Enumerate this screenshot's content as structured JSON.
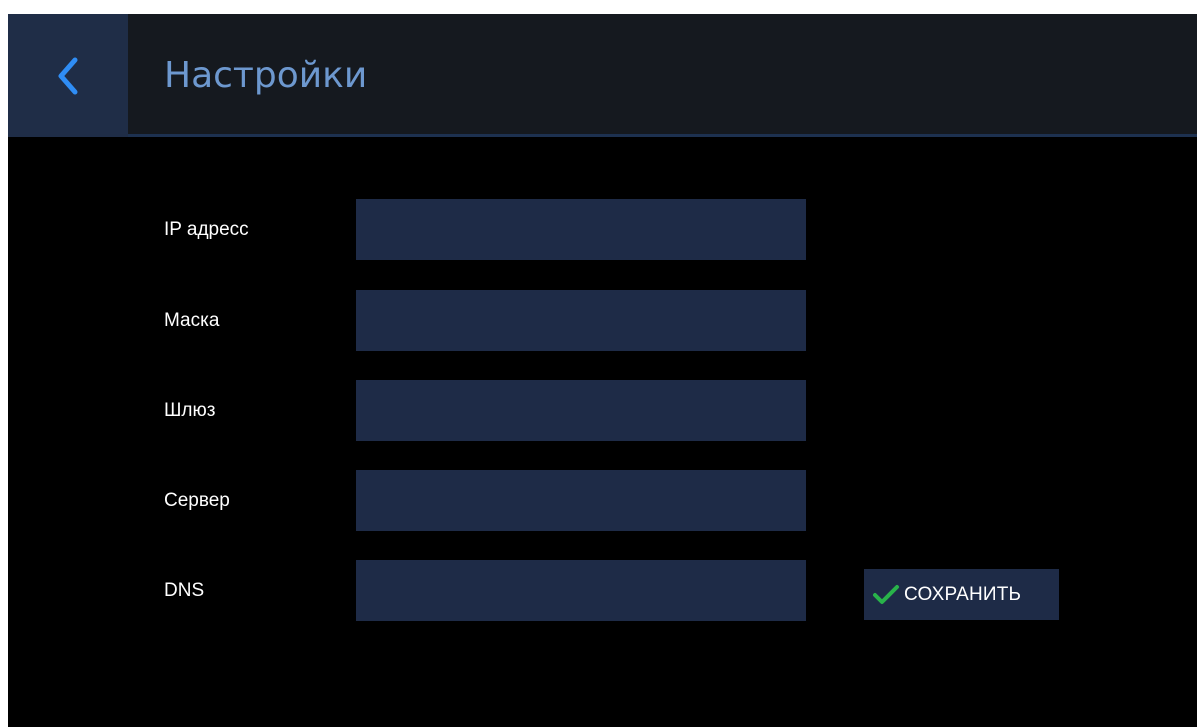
{
  "header": {
    "title": "Настройки",
    "back_icon": "chevron-left-icon"
  },
  "form": {
    "fields": [
      {
        "label": "IP адресс",
        "value": "",
        "placeholder": ""
      },
      {
        "label": "Маска",
        "value": "",
        "placeholder": ""
      },
      {
        "label": "Шлюз",
        "value": "",
        "placeholder": ""
      },
      {
        "label": "Сервер",
        "value": "",
        "placeholder": ""
      },
      {
        "label": "DNS",
        "value": "",
        "placeholder": ""
      }
    ],
    "save_label": "СОХРАНИТЬ",
    "save_icon": "checkmark-icon"
  },
  "colors": {
    "background": "#000000",
    "header_background": "#15191f",
    "back_button_background": "#1f2d47",
    "accent": "#2f8df5",
    "title": "#6d98cf",
    "field_background": "#1e2b47",
    "check": "#29b34a",
    "text": "#ffffff"
  }
}
